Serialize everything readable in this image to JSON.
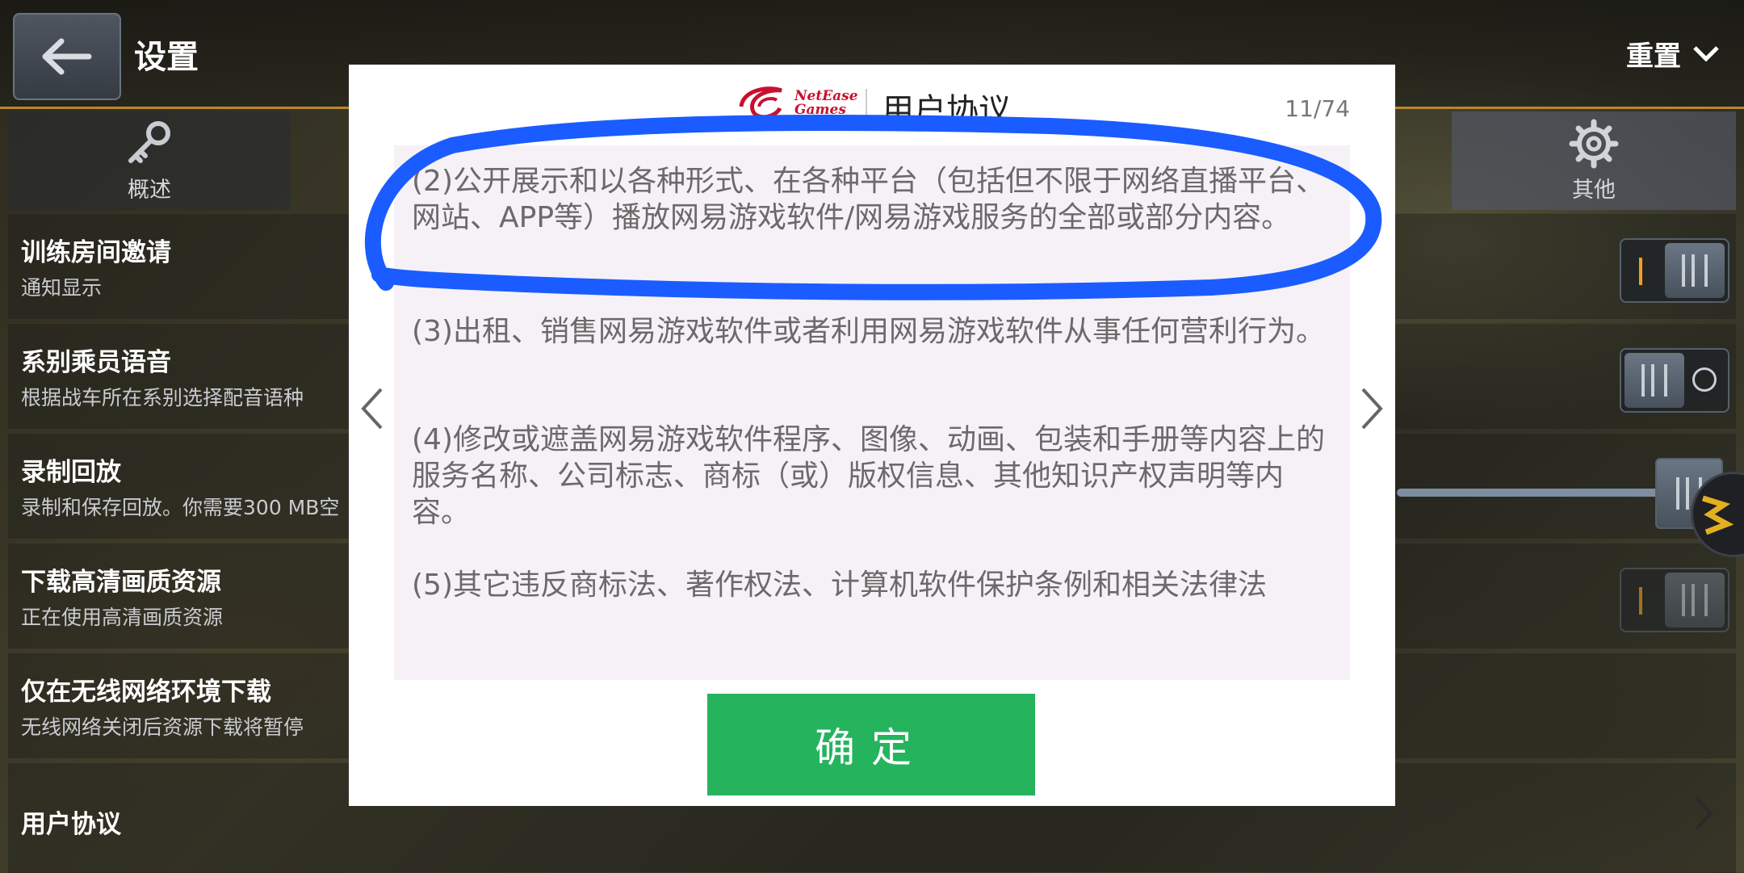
{
  "header": {
    "title": "设置",
    "reset_label": "重置"
  },
  "tabs": [
    {
      "label": "概述",
      "icon": "key-icon"
    },
    {
      "label": "其他",
      "icon": "gear-icon"
    }
  ],
  "settings": [
    {
      "label": "训练房间邀请",
      "sub": "通知显示",
      "control": "toggle",
      "state": "on"
    },
    {
      "label": "系别乘员语音",
      "sub": "根据战车所在系别选择配音语种",
      "control": "toggle",
      "state": "off"
    },
    {
      "label": "录制回放",
      "sub": "录制和保存回放。你需要300 MB空",
      "control": "slider"
    },
    {
      "label": "下载高清画质资源",
      "sub": "正在使用高清画质资源",
      "control": "toggle",
      "state": "on"
    },
    {
      "label": "仅在无线网络环境下载",
      "sub": "无线网络关闭后资源下载将暂停",
      "control": "none"
    },
    {
      "label": "用户协议",
      "sub": "",
      "control": "link"
    }
  ],
  "dialog": {
    "logo_line1": "NetEase",
    "logo_line2": "Games",
    "title": "用户协议",
    "page": "11/74",
    "paragraphs": [
      "(2)公开展示和以各种形式、在各种平台（包括但不限于网络直播平台、网站、APP等）播放网易游戏软件/网易游戏服务的全部或部分内容。",
      "(3)出租、销售网易游戏软件或者利用网易游戏软件从事任何营利行为。",
      "(4)修改或遮盖网易游戏软件程序、图像、动画、包装和手册等内容上的服务名称、公司标志、商标（或）版权信息、其他知识产权声明等内容。",
      "(5)其它违反商标法、著作权法、计算机软件保护条例和相关法律法"
    ],
    "confirm_label": "确定"
  },
  "colors": {
    "confirm": "#26b35e",
    "annotation": "#1a5cff",
    "accent": "#b8862c"
  }
}
